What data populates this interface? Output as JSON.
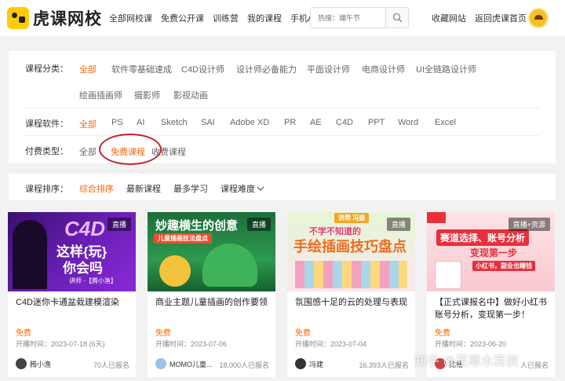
{
  "header": {
    "logo_text": "虎课网校",
    "nav": [
      "全部网校课",
      "免费公开课",
      "训练营",
      "我的课程",
      "手机APP"
    ],
    "search_placeholder": "热搜：端午节",
    "right_links": [
      "收藏网站",
      "返回虎课首页"
    ]
  },
  "filters": {
    "category": {
      "label": "课程分类：",
      "options": [
        "全部",
        "软件零基础速成",
        "C4D设计师",
        "设计师必备能力",
        "平面设计师",
        "电商设计师",
        "UI全链路设计师",
        "绘画插画师",
        "摄影师",
        "影视动画"
      ],
      "active": "全部"
    },
    "software": {
      "label": "课程软件：",
      "options": [
        "全部",
        "PS",
        "AI",
        "Sketch",
        "SAI",
        "Adobe XD",
        "PR",
        "AE",
        "C4D",
        "PPT",
        "Word",
        "Excel"
      ],
      "active": "全部"
    },
    "payment": {
      "label": "付费类型：",
      "options": [
        "全部",
        "免费课程",
        "收费课程"
      ],
      "active": "免费课程"
    }
  },
  "sort": {
    "label": "课程排序：",
    "options": [
      "综合排序",
      "最新课程",
      "最多学习",
      "课程难度"
    ],
    "active": "综合排序"
  },
  "cards": [
    {
      "badge": "直播",
      "thumb_lines": [
        "C4D",
        "这样{玩}",
        "你会吗",
        "讲师 -【腾小渔】"
      ],
      "title": "C4D迷你卡通盆栽建模渲染",
      "price": "免费",
      "date": "开播时间：2023-07-18 (6天)",
      "teacher": "腾小渔",
      "count": "70人已报名"
    },
    {
      "badge": "直播",
      "thumb_lines": [
        "妙趣横生的创意",
        "儿童插画技法盘点"
      ],
      "title": "商业主题儿童插画的创作要领",
      "price": "免费",
      "date": "开播时间：2023-07-06",
      "teacher": "MOMO儿童...",
      "count": "18,000人已报名"
    },
    {
      "badge": "直播",
      "thumb_lines": [
        "讲师 冯建",
        "不学不知道的",
        "手绘插画技巧盘点"
      ],
      "title": "氛围感十足的云的处理与表现",
      "price": "免费",
      "date": "开播时间：2023-07-04",
      "teacher": "冯建",
      "count": "16,393人已报名"
    },
    {
      "badge": "直播+资源",
      "thumb_lines": [
        "赛道选择、账号分析",
        "变现第一步",
        "小红书，副业也赚钱"
      ],
      "title": "【正式课报名中】做好小红书账号分析，变现第一步！",
      "price": "免费",
      "date": "开播时间：2023-06-20",
      "teacher": "比格",
      "count": "人已报名"
    }
  ],
  "watermark": "知乎 @至尊木耳侠"
}
